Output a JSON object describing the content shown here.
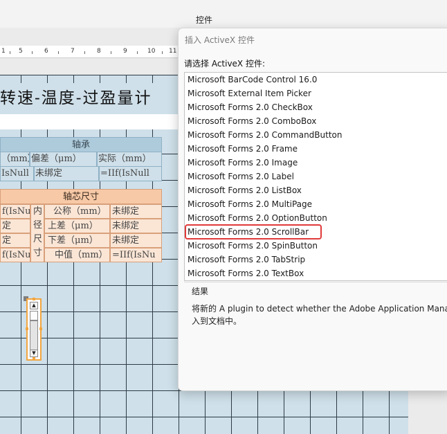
{
  "app": {
    "title": "控件"
  },
  "ruler": {
    "marks": [
      "1",
      "5",
      "6",
      "7",
      "8",
      "9",
      "10",
      "11"
    ]
  },
  "report": {
    "title": "转速-温度-过盈量计",
    "bearing_table": {
      "header": "轴承",
      "row1": [
        "（mm）",
        "偏差（μm）",
        "实际（mm）"
      ],
      "row2": [
        "IsNull",
        "未绑定",
        "=IIf(IsNull"
      ]
    },
    "core_table": {
      "header": "轴芯尺寸",
      "left_col": [
        "f(IsNu",
        "定",
        "定",
        "f(IsNu"
      ],
      "vertical_label": [
        "内",
        "径",
        "尺",
        "寸"
      ],
      "labels": [
        "公称（mm）",
        "上差（μm）",
        "下差（μm）",
        "中值（mm）"
      ],
      "values": [
        "未绑定",
        "未绑定",
        "未绑定",
        "=IIf(IsNu"
      ]
    }
  },
  "dialog": {
    "title": "插入 ActiveX 控件",
    "prompt": "请选择 ActiveX 控件:",
    "items": [
      "Microsoft BarCode Control 16.0",
      "Microsoft External Item Picker",
      "Microsoft Forms 2.0 CheckBox",
      "Microsoft Forms 2.0 ComboBox",
      "Microsoft Forms 2.0 CommandButton",
      "Microsoft Forms 2.0 Frame",
      "Microsoft Forms 2.0 Image",
      "Microsoft Forms 2.0 Label",
      "Microsoft Forms 2.0 ListBox",
      "Microsoft Forms 2.0 MultiPage",
      "Microsoft Forms 2.0 OptionButton",
      "Microsoft Forms 2.0 ScrollBar",
      "Microsoft Forms 2.0 SpinButton",
      "Microsoft Forms 2.0 TabStrip",
      "Microsoft Forms 2.0 TextBox"
    ],
    "selected_index": 11,
    "result_label": "结果",
    "result_line1": "将新的 A plugin to detect whether the Adobe Application Manag",
    "result_line2": "入到文档中。"
  },
  "colors": {
    "selection_outline": "#e03a3a",
    "grid_fill": "#cfe0ea",
    "bearing_header": "#aecbdc",
    "core_header": "#f7c9a6",
    "control_outline": "#f2a640"
  }
}
